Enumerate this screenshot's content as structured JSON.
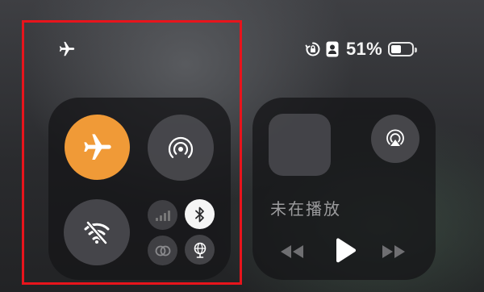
{
  "status_bar": {
    "airplane_icon": "airplane-icon",
    "rotation_lock_icon": "rotation-lock-icon",
    "focus_icon": "person-badge-icon",
    "battery_percent_text": "51%",
    "battery_level": 0.51
  },
  "connectivity": {
    "airplane_mode": {
      "icon": "airplane-icon",
      "active": true,
      "color": "#f09a37"
    },
    "airdrop": {
      "icon": "airdrop-icon",
      "active": false
    },
    "wifi": {
      "icon": "wifi-off-icon",
      "active": false
    },
    "cellular": {
      "icon": "cellular-signal-icon",
      "active": false
    },
    "bluetooth": {
      "icon": "bluetooth-icon",
      "active": true
    },
    "vpn": {
      "icon": "vpn-link-icon",
      "active": false
    },
    "hotspot": {
      "icon": "globe-hotspot-icon",
      "active": false
    }
  },
  "media": {
    "now_playing": "未在播放",
    "airplay_icon": "airplay-icon",
    "controls": [
      "rewind-icon",
      "play-icon",
      "fast-forward-icon"
    ]
  },
  "highlight_color": "#e8141c"
}
